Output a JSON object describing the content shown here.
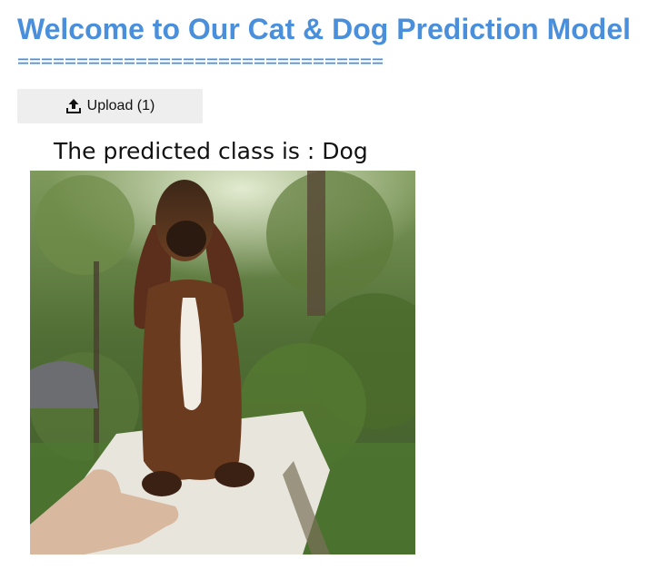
{
  "header": {
    "title": "Welcome to Our Cat & Dog Prediction Model",
    "divider": "==============================="
  },
  "upload": {
    "label": "Upload (1)",
    "icon": "upload-icon"
  },
  "result": {
    "text": "The predicted class is : Dog"
  },
  "image": {
    "subject": "dog-photo"
  },
  "colors": {
    "accent": "#4a8fdc",
    "button_bg": "#eeeeee"
  }
}
